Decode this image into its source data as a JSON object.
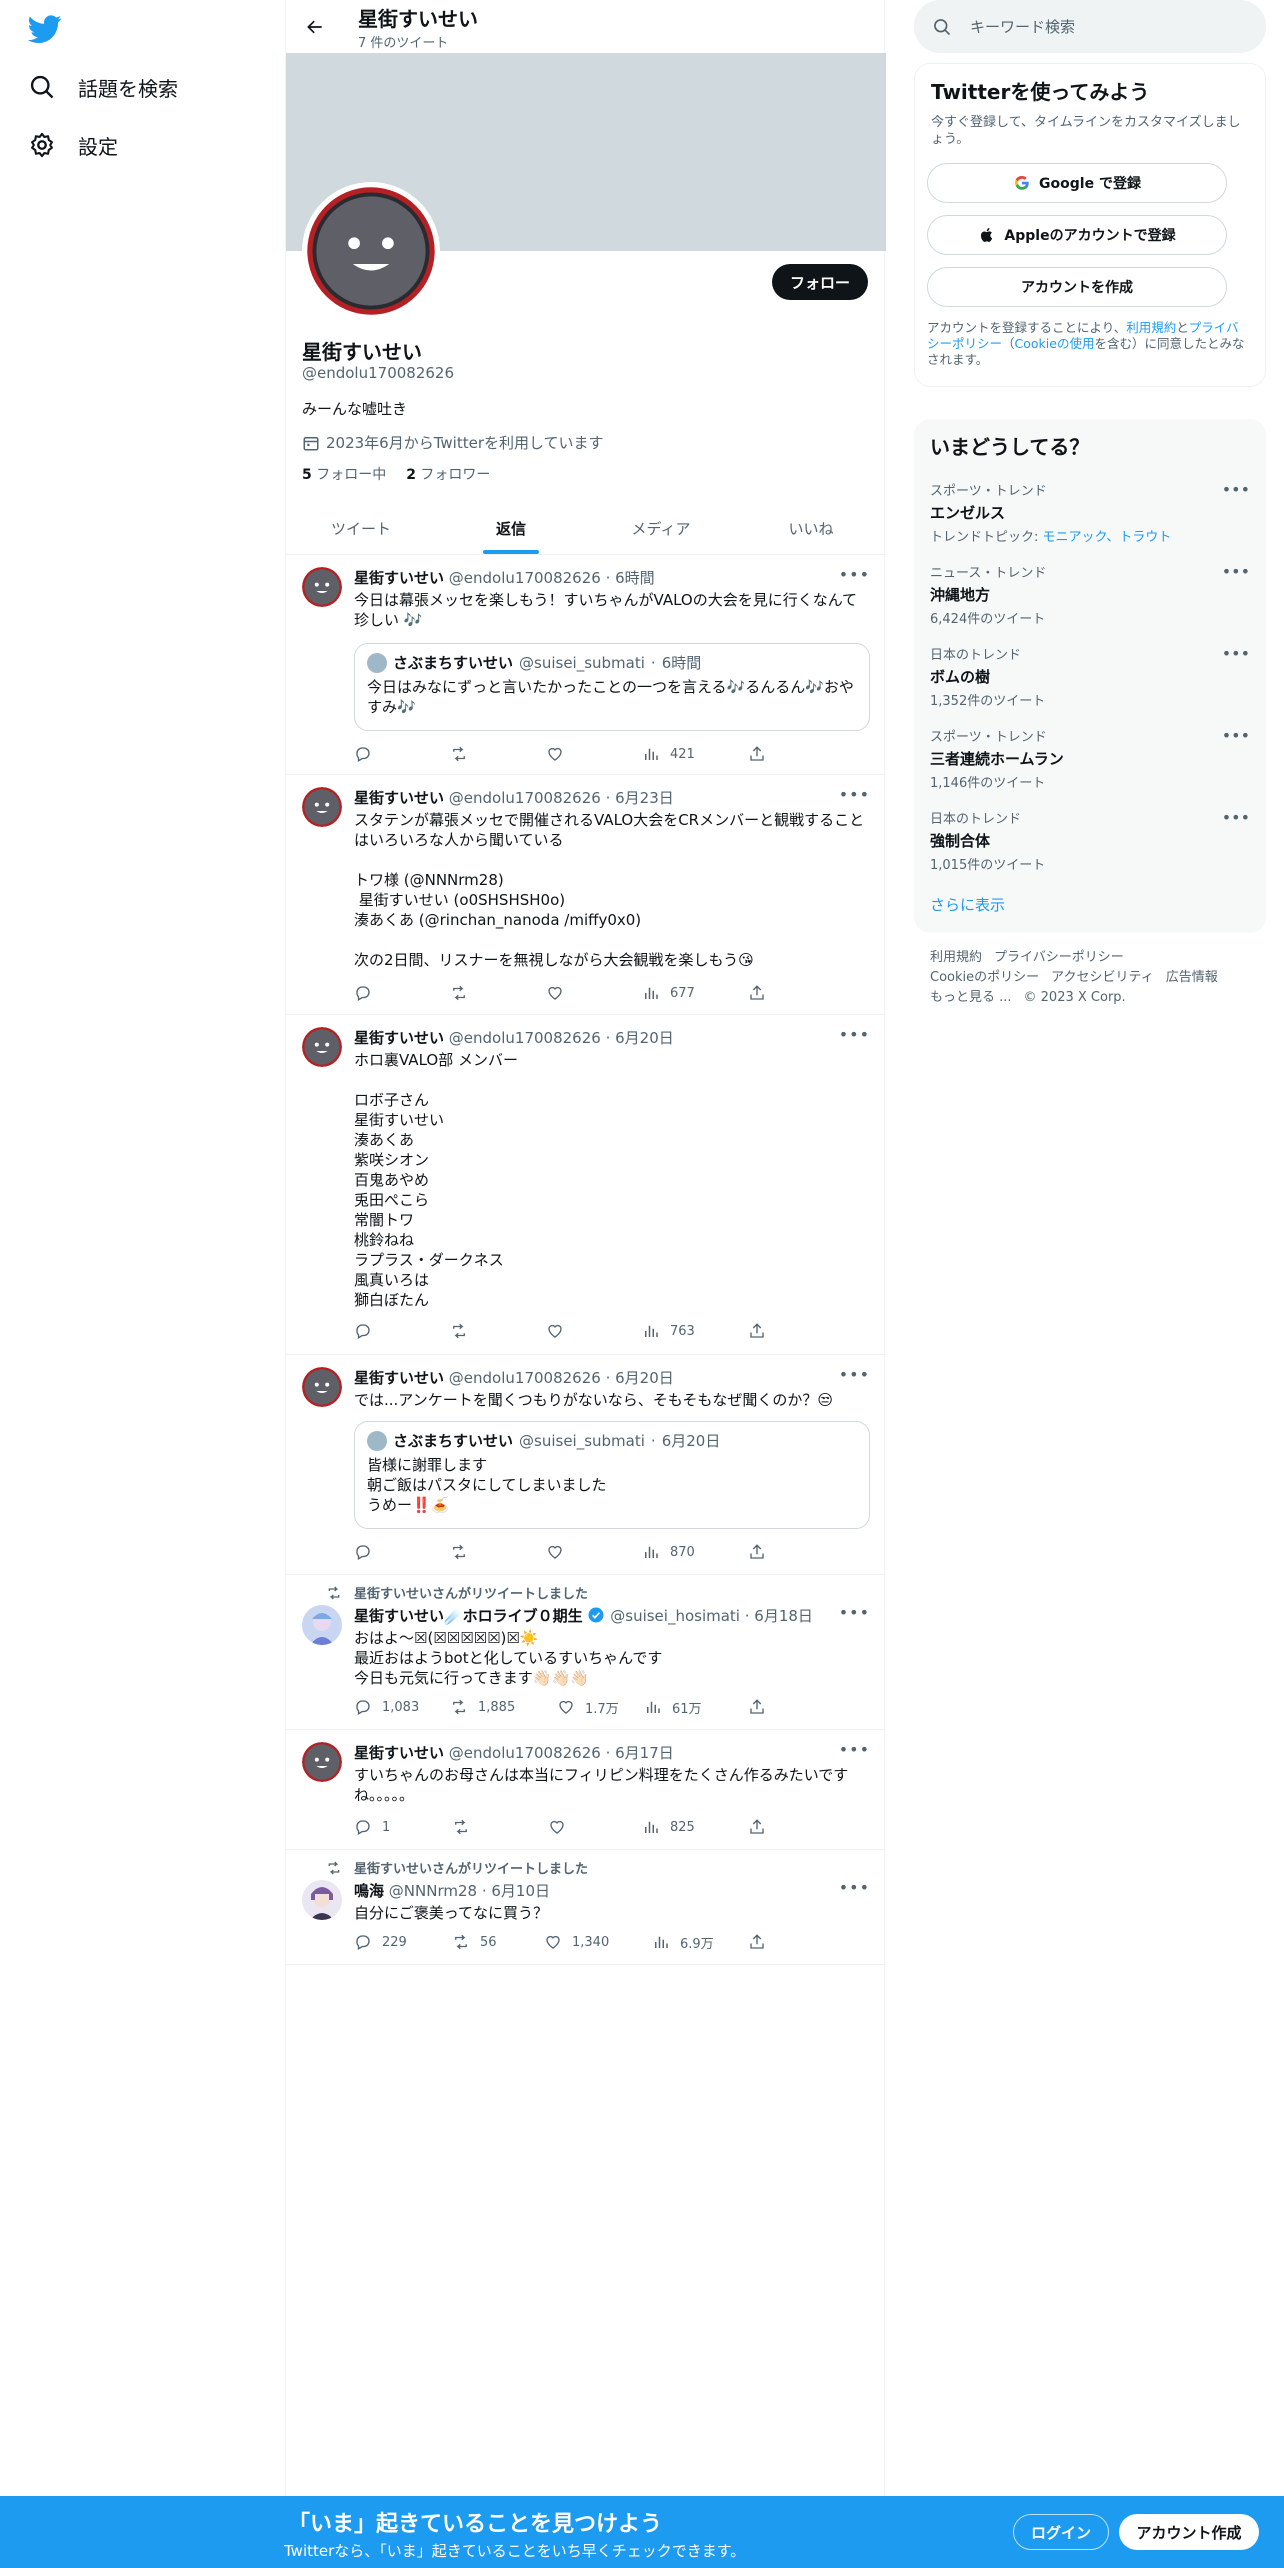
{
  "nav": {
    "items": [
      {
        "label": "話題を検索",
        "icon": "search-icon"
      },
      {
        "label": "設定",
        "icon": "gear-icon"
      }
    ]
  },
  "header": {
    "title": "星街すいせい",
    "subtitle": "7 件のツイート"
  },
  "profile": {
    "name": "星街すいせい",
    "handle": "@endolu170082626",
    "bio": "みーんな嘘吐き",
    "joined": "2023年6月からTwitterを利用しています",
    "following_count": "5",
    "following_label": "フォロー中",
    "followers_count": "2",
    "followers_label": "フォロワー",
    "follow_button": "フォロー"
  },
  "tabs": [
    {
      "label": "ツイート"
    },
    {
      "label": "返信",
      "active": true
    },
    {
      "label": "メディア"
    },
    {
      "label": "いいね"
    }
  ],
  "tweets": [
    {
      "name": "星街すいせい",
      "handle": "@endolu170082626",
      "time": "6時間",
      "text": "今日は幕張メッセを楽しもう！すいちゃんがVALOの大会を見に行くなんて珍しい 🎶",
      "quote": {
        "name": "さぶまちすいせい",
        "handle": "@suisei_submati",
        "time": "6時間",
        "text": "今日はみなにずっと言いたかったことの一つを言える🎶るんるん🎶おやすみ🎶"
      },
      "views": "421"
    },
    {
      "name": "星街すいせい",
      "handle": "@endolu170082626",
      "time": "6月23日",
      "text": "スタテンが幕張メッセで開催されるVALO大会をCRメンバーと観戦することはいろいろな人から聞いている\n\nトワ様 (@NNNrm28)\n 星街すいせい (o0SHSHSH0o)\n湊あくあ (@rinchan_nanoda /miffy0x0)\n\n次の2日間、リスナーを無視しながら大会観戦を楽しもう😘",
      "views": "677"
    },
    {
      "name": "星街すいせい",
      "handle": "@endolu170082626",
      "time": "6月20日",
      "text": "ホロ裏VALO部 メンバー\n\nロボ子さん\n星街すいせい\n湊あくあ\n紫咲シオン\n百鬼あやめ\n兎田ぺこら\n常闇トワ\n桃鈴ねね\nラプラス・ダークネス\n風真いろは\n獅白ぼたん",
      "views": "763"
    },
    {
      "name": "星街すいせい",
      "handle": "@endolu170082626",
      "time": "6月20日",
      "text": "では...アンケートを聞くつもりがないなら、そもそもなぜ聞くのか？😒",
      "quote": {
        "name": "さぶまちすいせい",
        "handle": "@suisei_submati",
        "time": "6月20日",
        "text": "皆様に謝罪します\n朝ご飯はパスタにしてしまいました\nうめー‼️🍝"
      },
      "views": "870"
    },
    {
      "retweeted_by": "星街すいせいさんがリツイートしました",
      "name": "星街すいせい☄️ホロライブ０期生",
      "verified": true,
      "handle": "@suisei_hosimati",
      "time": "6月18日",
      "text": "おはよ〜☒(☒☒☒☒☒)☒☀️\n最近おはようbotと化しているすいちゃんです\n今日も元気に行ってきます👋🏻👋🏻👋🏻",
      "replies": "1,083",
      "retweets": "1,885",
      "likes": "1.7万",
      "views": "61万"
    },
    {
      "name": "星街すいせい",
      "handle": "@endolu170082626",
      "time": "6月17日",
      "text": "すいちゃんのお母さんは本当にフィリピン料理をたくさん作るみたいですね。。。。。",
      "replies": "1",
      "views": "825"
    },
    {
      "retweeted_by": "星街すいせいさんがリツイートしました",
      "name": "鳴海",
      "handle": "@NNNrm28",
      "time": "6月10日",
      "text": "自分にご褒美ってなに買う？",
      "replies": "229",
      "retweets": "56",
      "likes": "1,340",
      "views": "6.9万"
    }
  ],
  "search": {
    "placeholder": "キーワード検索"
  },
  "signup_box": {
    "title": "Twitterを使ってみよう",
    "subtitle": "今すぐ登録して、タイムラインをカスタマイズしましょう。",
    "google": "Google で登録",
    "apple": "Appleのアカウントで登録",
    "create": "アカウントを作成",
    "terms_1": "アカウントを登録することにより、",
    "terms_link1": "利用規約",
    "terms_2": "と",
    "terms_link2": "プライバシーポリシー",
    "terms_3": "（",
    "terms_link3": "Cookieの使用",
    "terms_4": "を含む）に同意したとみなされます。"
  },
  "trends": {
    "title": "いまどうしてる？",
    "items": [
      {
        "category": "スポーツ・トレンド",
        "name": "エンゼルス",
        "sub_prefix": "トレンドトピック: ",
        "sub_links": "モニアック、トラウト"
      },
      {
        "category": "ニュース・トレンド",
        "name": "沖縄地方",
        "sub": "6,424件のツイート"
      },
      {
        "category": "日本のトレンド",
        "name": "ボムの樹",
        "sub": "1,352件のツイート"
      },
      {
        "category": "スポーツ・トレンド",
        "name": "三者連続ホームラン",
        "sub": "1,146件のツイート"
      },
      {
        "category": "日本のトレンド",
        "name": "強制合体",
        "sub": "1,015件のツイート"
      }
    ],
    "show_more": "さらに表示"
  },
  "footer": {
    "links": [
      "利用規約",
      "プライバシーポリシー",
      "Cookieのポリシー",
      "アクセシビリティ",
      "広告情報",
      "もっと見る ..."
    ],
    "copyright": "© 2023 X Corp."
  },
  "bottom": {
    "title": "「いま」起きていることを見つけよう",
    "subtitle": "Twitterなら、「いま」起きていることをいち早くチェックできます。",
    "login": "ログイン",
    "signup": "アカウント作成"
  },
  "colors": {
    "brand": "#1d9bf0",
    "text": "#0f1419",
    "muted": "#536471",
    "banner": "#cfd9de"
  }
}
